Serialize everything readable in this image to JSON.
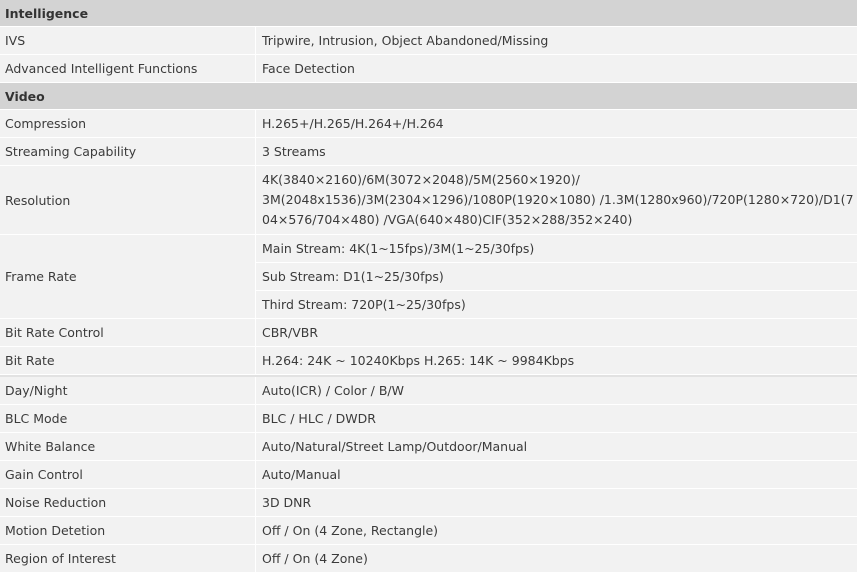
{
  "sections": {
    "intelligence": "Intelligence",
    "video": "Video"
  },
  "rows": {
    "ivs": {
      "label": "IVS",
      "value": "Tripwire, Intrusion, Object Abandoned/Missing"
    },
    "aif": {
      "label": "Advanced Intelligent Functions",
      "value": "Face Detection"
    },
    "compression": {
      "label": "Compression",
      "value": "H.265+/H.265/H.264+/H.264"
    },
    "streaming": {
      "label": "Streaming Capability",
      "value": "3 Streams"
    },
    "resolution": {
      "label": "Resolution",
      "lines": [
        "4K(3840×2160)/6M(3072×2048)/5M(2560×1920)/",
        "3M(2048x1536)/3M(2304×1296)/1080P(1920×1080) /1.3M(1280x960)/720P(1280×720)/D1(7",
        "04×576/704×480) /VGA(640×480)CIF(352×288/352×240)"
      ]
    },
    "framerate": {
      "label": "Frame Rate",
      "main": "Main Stream: 4K(1~15fps)/3M(1~25/30fps)",
      "sub": "Sub Stream: D1(1~25/30fps)",
      "third": "Third Stream: 720P(1~25/30fps)"
    },
    "bitrate_control": {
      "label": "Bit Rate Control",
      "value": "CBR/VBR"
    },
    "bitrate": {
      "label": "Bit Rate",
      "value": "H.264: 24K ~ 10240Kbps H.265: 14K ~ 9984Kbps"
    },
    "daynight": {
      "label": "Day/Night",
      "value": "Auto(ICR) / Color / B/W"
    },
    "blc": {
      "label": "BLC Mode",
      "value": "BLC / HLC / DWDR"
    },
    "wb": {
      "label": "White Balance",
      "value": "Auto/Natural/Street Lamp/Outdoor/Manual"
    },
    "gain": {
      "label": "Gain Control",
      "value": "Auto/Manual"
    },
    "noise": {
      "label": "Noise Reduction",
      "value": "3D DNR"
    },
    "motion": {
      "label": "Motion Detetion",
      "value": "Off / On (4 Zone, Rectangle)"
    },
    "roi": {
      "label": "Region of Interest",
      "value": "Off / On (4 Zone)"
    }
  }
}
